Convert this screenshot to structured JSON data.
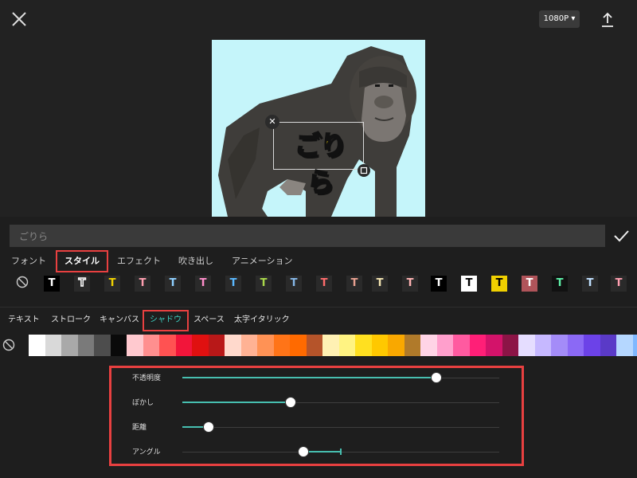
{
  "topbar": {
    "resolution_label": "1080P ▾"
  },
  "text_input": {
    "value": "ごりら"
  },
  "sticker_text": "ごりら",
  "tabs": [
    {
      "label": "フォント"
    },
    {
      "label": "スタイル"
    },
    {
      "label": "エフェクト"
    },
    {
      "label": "吹き出し"
    },
    {
      "label": "アニメーション"
    }
  ],
  "style_glyph": "T",
  "subtabs": [
    {
      "label": "テキスト"
    },
    {
      "label": "ストローク"
    },
    {
      "label": "キャンバス"
    },
    {
      "label": "シャドウ"
    },
    {
      "label": "スペース"
    },
    {
      "label": "太字イタリック"
    }
  ],
  "colors": [
    "#ffffff",
    "#d9d9d9",
    "#a9a9a9",
    "#7a7a7a",
    "#4d4d4d",
    "#0a0a0a",
    "#ffc9cf",
    "#ff8f8f",
    "#ff5252",
    "#f2153a",
    "#e01010",
    "#b81818",
    "#ffd9cc",
    "#ffb294",
    "#ff9255",
    "#ff7418",
    "#ff6a00",
    "#b5542a",
    "#fff1b3",
    "#fff382",
    "#ffe020",
    "#ffc800",
    "#f9a800",
    "#b07a2a",
    "#ffd4e6",
    "#ff9fcc",
    "#ff5aa0",
    "#ff1f77",
    "#d3136a",
    "#8c1446",
    "#e5ddff",
    "#c6b8ff",
    "#a48cf8",
    "#8b69f5",
    "#6c42e8",
    "#5a3ac7",
    "#b5d7ff",
    "#80b8ff"
  ],
  "sliders": [
    {
      "label": "不透明度",
      "value": 0.8
    },
    {
      "label": "ぼかし",
      "value": 0.34
    },
    {
      "label": "距離",
      "value": 0.08
    },
    {
      "label": "アングル",
      "value": 0.38,
      "fill_end": 0.5
    }
  ]
}
